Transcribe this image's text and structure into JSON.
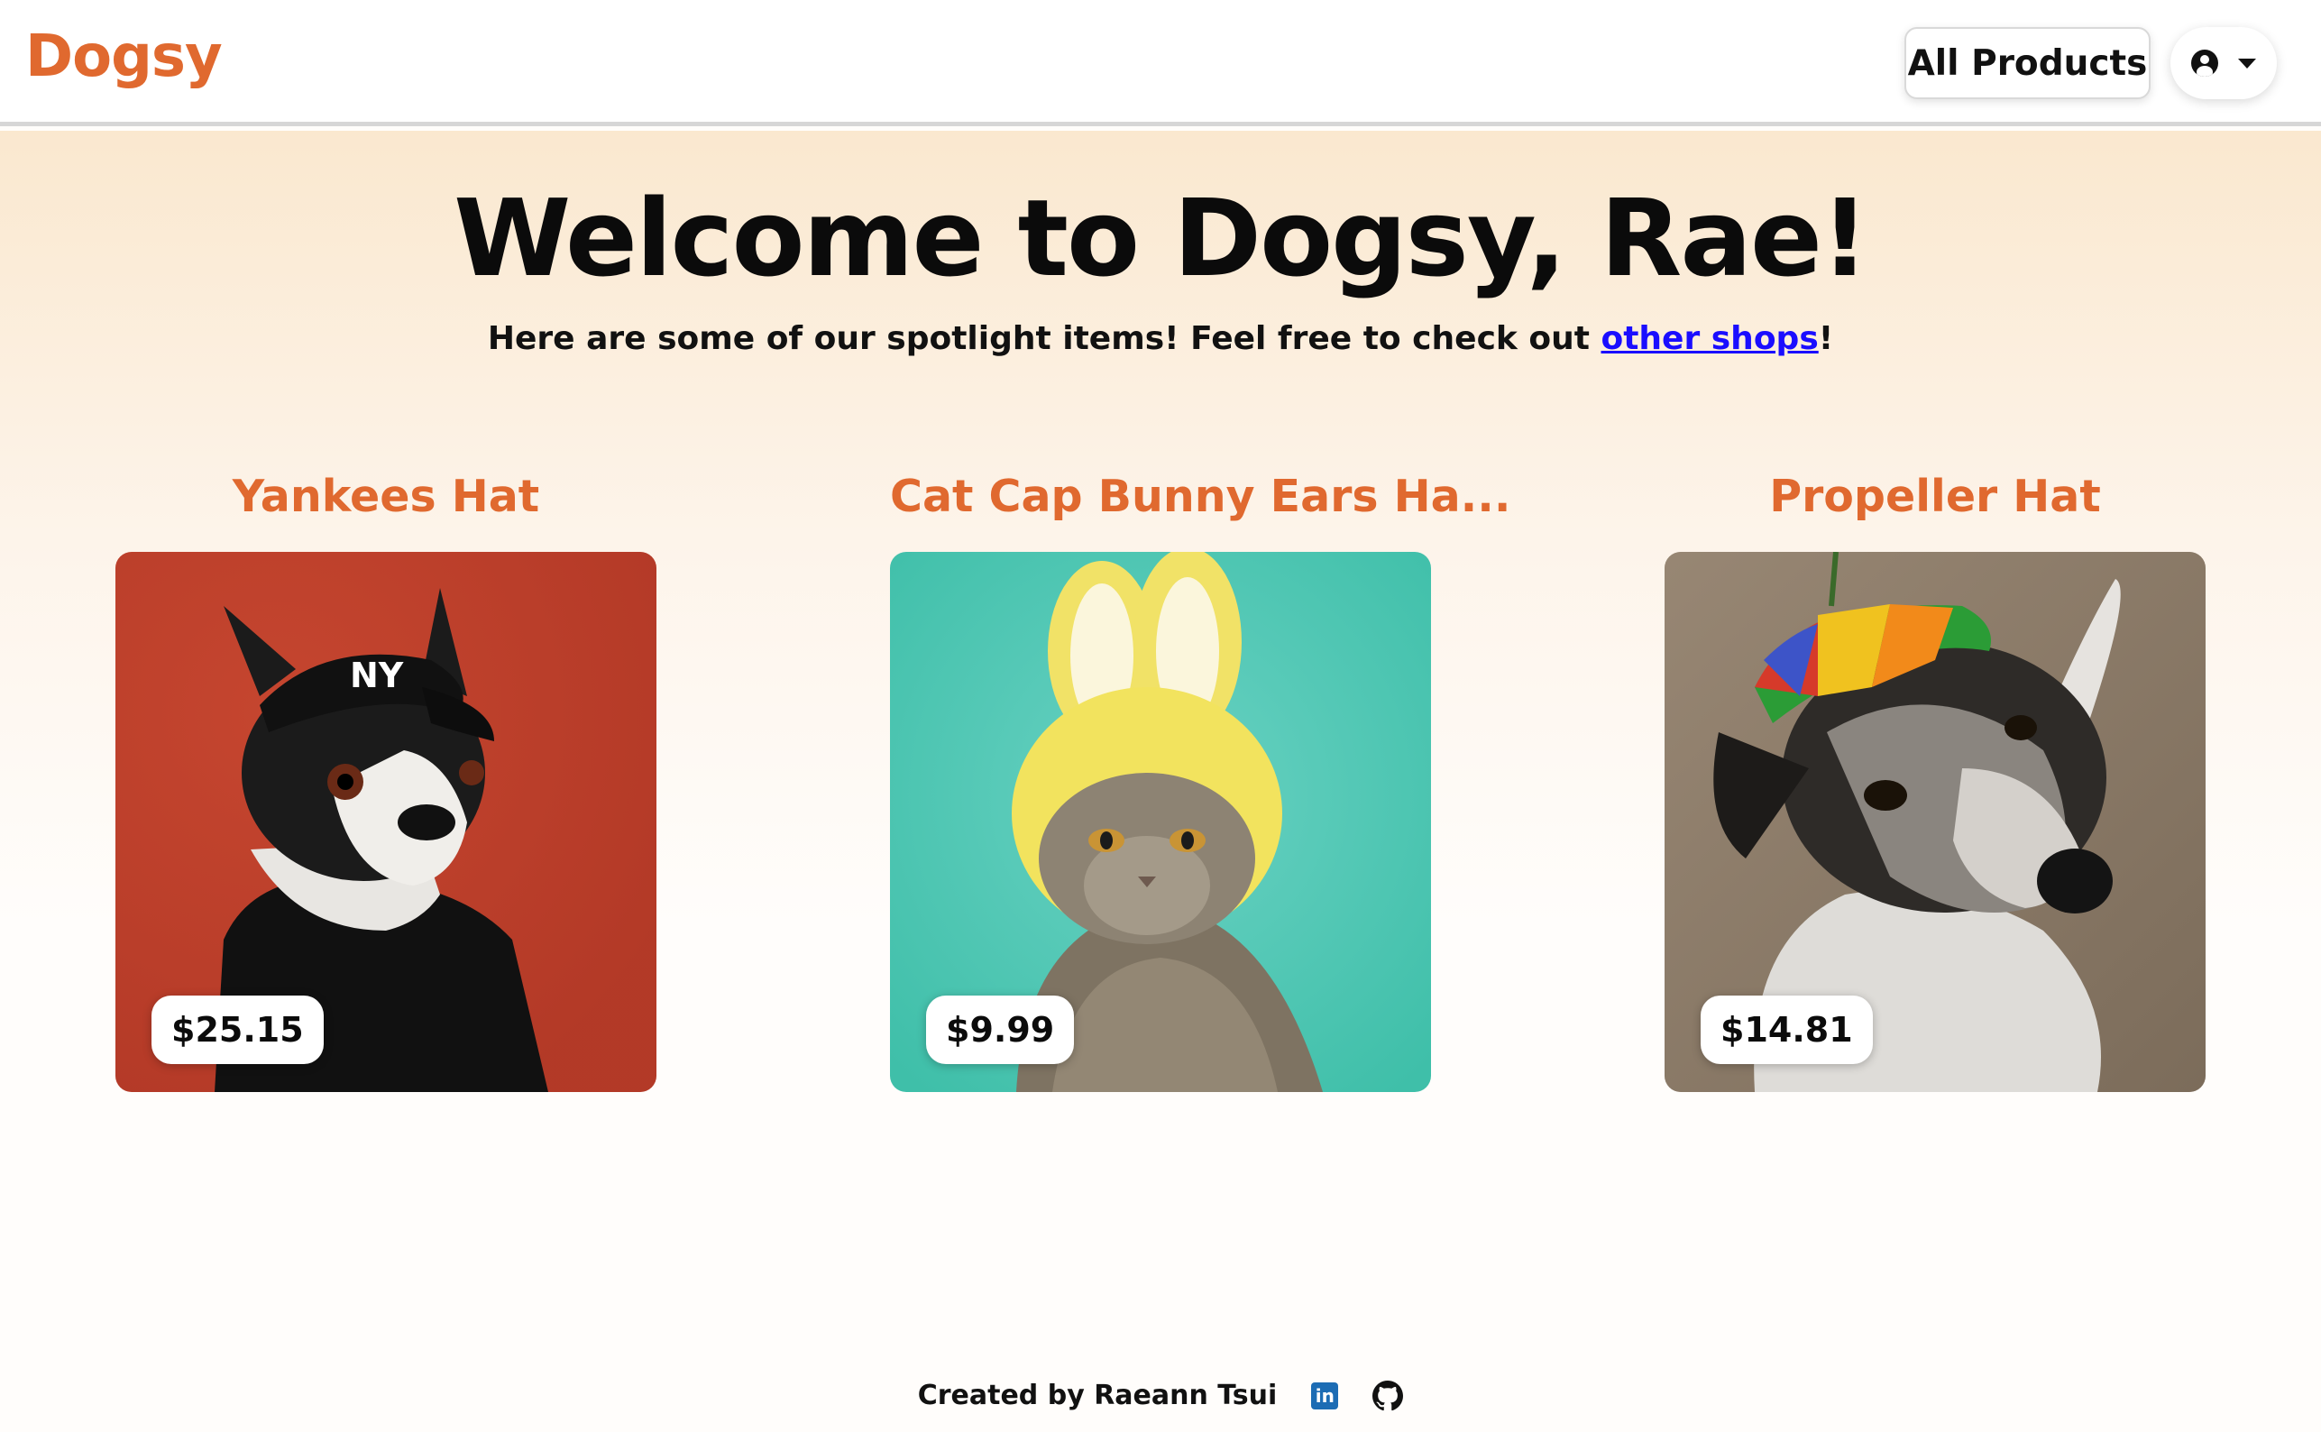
{
  "header": {
    "logo": "Dogsy",
    "all_products_label": "All Products",
    "profile_icon": "user-circle-icon",
    "dropdown_icon": "caret-down-icon"
  },
  "hero": {
    "title": "Welcome to Dogsy, Rae!",
    "subtitle_before": "Here are some of our spotlight items! Feel free to check out ",
    "subtitle_link": "other shops",
    "subtitle_after": "!"
  },
  "products": [
    {
      "title": "Yankees Hat",
      "price": "$25.15",
      "image": "dog-in-yankees-cap"
    },
    {
      "title": "Cat Cap Bunny Ears Ha...",
      "price": "$9.99",
      "image": "cat-in-bunny-ears-cap"
    },
    {
      "title": "Propeller Hat",
      "price": "$14.81",
      "image": "dog-in-propeller-hat"
    }
  ],
  "footer": {
    "credit": "Created by Raeann Tsui",
    "linkedin_icon": "linkedin-icon",
    "github_icon": "github-icon"
  },
  "colors": {
    "brand": "#e0692f",
    "link": "#1a0dff"
  }
}
